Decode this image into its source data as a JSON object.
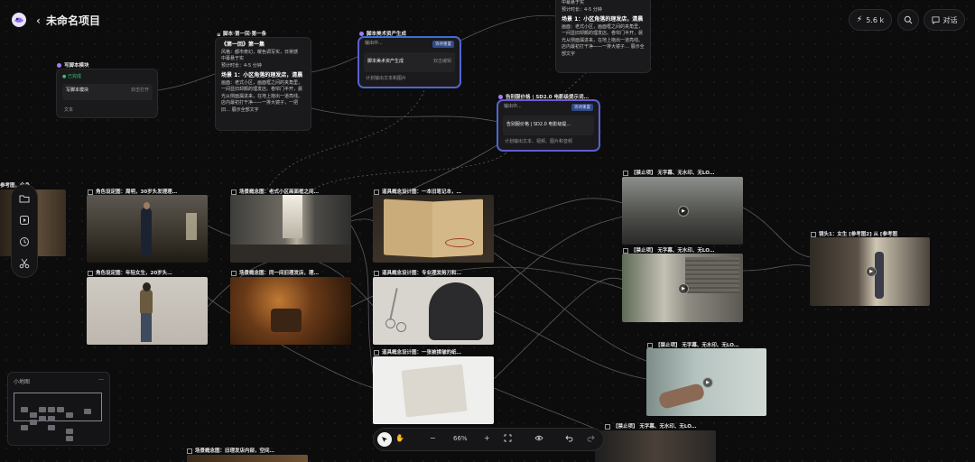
{
  "header": {
    "title": "未命名项目",
    "back_icon": "chevron-left-icon",
    "credits": "5.6 k",
    "chat_label": "对话"
  },
  "nodes": {
    "write_script": {
      "title": "写脚本模块",
      "status": "已完成",
      "inner_label": "写脚本模块",
      "inner_hint": "双击打开",
      "footer": "文本"
    },
    "script_ep1": {
      "title": "脚本·第一回·第一条",
      "heading": "《第一回》第一集",
      "line1": "风格：都市奇幻，暖色调写实，日常感",
      "line2": "中幕悬于实",
      "line3": "预计时长：4-5 分钟",
      "scene": "场景 1：小区角落的理发店，清晨",
      "body": "画面：老式小区，画面框之间的夹角里，一间显旧却颇的理发店。卷帘门半开，晨光从侧面漏进来，在地上拖出一道亮线。店内最初打干净——一排大镜子，一把旧… 展示全部文字"
    },
    "art_gen": {
      "title": "脚本美术资产生成",
      "tag": "输出中...",
      "badge": "等待重置",
      "inner": "脚本美术资产生成",
      "inner_hint": "双击编辑",
      "footer": "计划输出文本和图片"
    },
    "top_text": {
      "line1": "中幕悬于实",
      "line2": "预计时长：4-5 分钟",
      "scene": "场景 1：小区角落的理发店，清晨",
      "body": "画面：老式小区，画面框之间的夹角里，一间显旧却颇的理发店。卷帘门半开，晨光从侧面漏进来，在地上拖出一道亮线。店内最初打干净——一排大镜子… 展示全部文字"
    },
    "storyboard": {
      "title": "告别服价格 | SD2.0 电影级提示词…",
      "tag": "输出中...",
      "badge": "等待重置",
      "inner": "告别服价格 | SD2.0 电影级提…",
      "footer": "计划输出文本、视频、图片和音频"
    }
  },
  "image_labels": {
    "char1": "角色设定图：周明，30岁头发理理…",
    "char2": "角色设定图：年轻女生，20岁头…",
    "scene1": "场景概念图：老式小区画面框之间…",
    "scene2": "场景概念图：同一间旧理发店，理…",
    "scene3": "场景概念图：旧理发店内部，空间…",
    "prop1": "道具概念设计图：一本旧笔记本，…",
    "prop2": "道具概念设计图：专业理发剪刀和…",
    "prop3": "道具概念设计图：一张被揉皱的纸…",
    "vid1": "【禁止项】 无字幕、无水印、无LO…",
    "vid2": "【禁止项】 无字幕、无水印、无LO…",
    "vid3": "【禁止项】 无字幕、无水印、无LO…",
    "vid4": "【禁止项】 无字幕、无水印、无LO…",
    "vid_right": "镜头1：女生 [参考图2] 从 [参考图",
    "partial_left": "参考图，全身"
  },
  "minimap": {
    "title": "小地图",
    "close": "—"
  },
  "toolbar": {
    "zoom": "66%",
    "minus": "−",
    "plus": "+"
  },
  "colors": {
    "accent": "#6d5bd0",
    "badge": "#3c6ad0",
    "success": "#38c172"
  }
}
